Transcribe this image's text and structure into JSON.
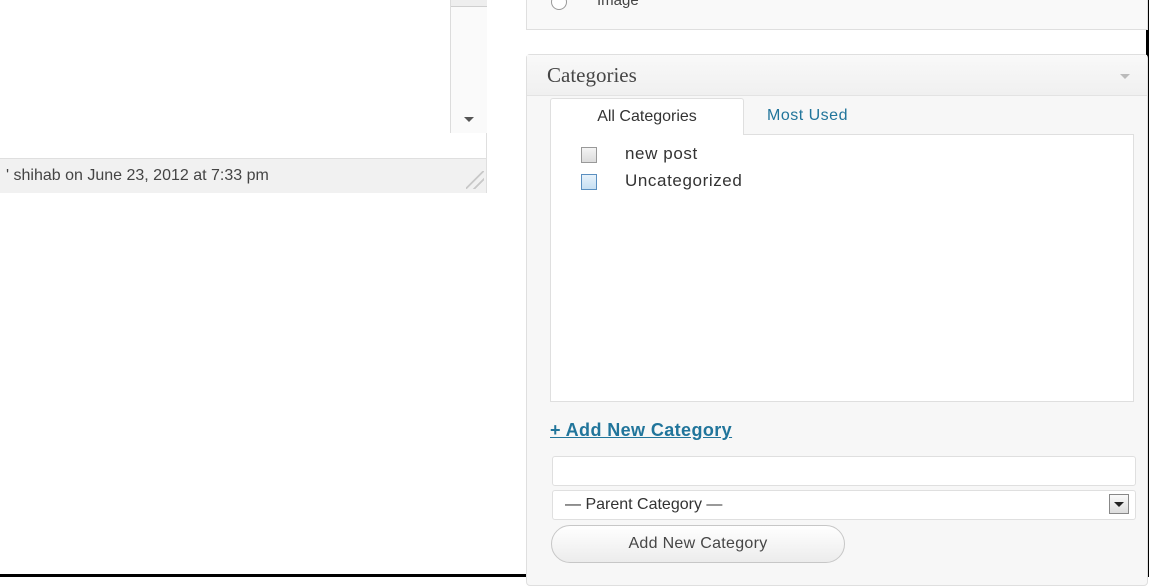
{
  "status_bar": {
    "text": "' shihab on June 23, 2012 at 7:33 pm"
  },
  "post_format": {
    "option_label": "Image"
  },
  "categories_box": {
    "title": "Categories",
    "tabs": [
      {
        "label": "All Categories",
        "active": true
      },
      {
        "label": "Most Used",
        "active": false
      }
    ],
    "items": [
      {
        "label": "new post",
        "checked": false
      },
      {
        "label": "Uncategorized",
        "checked": false
      }
    ],
    "add_new_link": "+ Add New Category",
    "new_category_input": {
      "value": "",
      "placeholder": ""
    },
    "parent_select": {
      "selected": "— Parent Category —"
    },
    "add_button": "Add New Category"
  },
  "colors": {
    "link": "#21759b",
    "panel_bg": "#f7f7f7",
    "border": "#dfdfdf"
  }
}
